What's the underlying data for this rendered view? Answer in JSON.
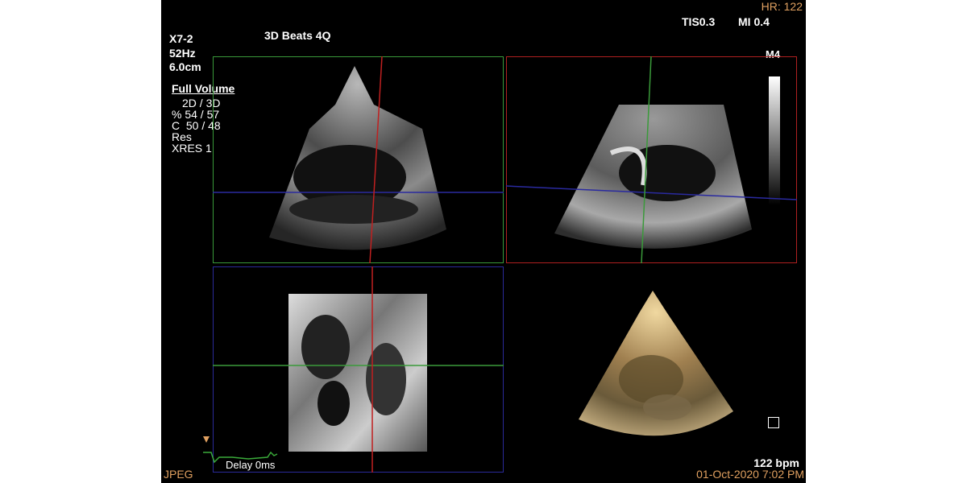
{
  "header": {
    "probe": "X7-2",
    "frame_rate": "52Hz",
    "depth": "6.0cm",
    "mode_title": "3D Beats 4Q",
    "hr": "HR: 122",
    "tis": "TIS0.3",
    "mi": "MI 0.4",
    "map": "M4"
  },
  "settings": {
    "heading": "Full Volume",
    "lines": [
      "2D / 3D",
      "% 54 / 57",
      "C  50 / 48",
      "Res",
      "XRES 1"
    ]
  },
  "footer": {
    "format": "JPEG",
    "delay": "Delay 0ms",
    "bpm": "122 bpm",
    "datetime": "01-Oct-2020 7:02 PM"
  },
  "colors": {
    "background": "#000000",
    "accent_orange": "#e0a060",
    "quad_green": "#3a9a3a",
    "quad_red": "#b02020",
    "quad_blue": "#2a2a9a"
  }
}
